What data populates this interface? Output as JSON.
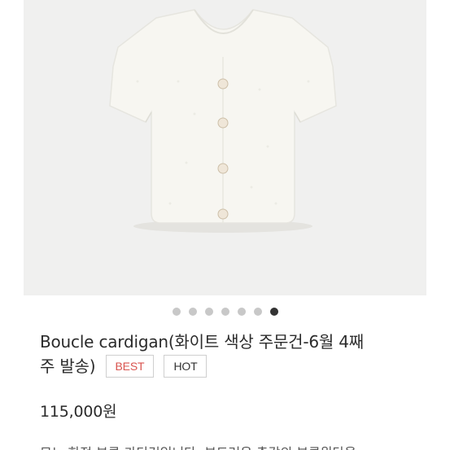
{
  "product": {
    "title_line1": "Boucle cardigan(화이트 색상 주문건-6월 4째",
    "title_line2": "주 발송)",
    "badges": {
      "best": "BEST",
      "hot": "HOT"
    },
    "price": "115,000원",
    "description_preview": "모노 한정 부클 가디건입니다. 부드러운 촉감의 부클원단을"
  },
  "carousel": {
    "total": 7,
    "active_index": 6
  },
  "colors": {
    "image_bg": "#f0f0ef",
    "garment": "#f7f6f1",
    "best_badge": "#d9544f",
    "dot_inactive": "#c8c8c8",
    "dot_active": "#333333"
  }
}
